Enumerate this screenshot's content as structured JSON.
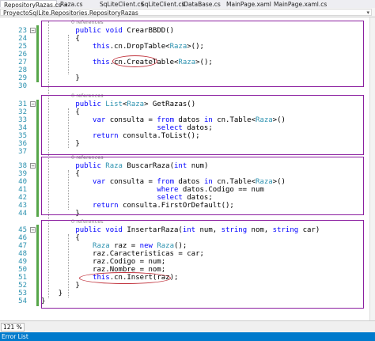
{
  "tabs": [
    {
      "label": "RepositoryRazas.cs",
      "active": true
    },
    {
      "label": "Raza.cs"
    },
    {
      "label": "SqLiteClient.cs"
    },
    {
      "label": "SqLiteClient.cs"
    },
    {
      "label": "IDataBase.cs"
    },
    {
      "label": "MainPage.xaml"
    },
    {
      "label": "MainPage.xaml.cs"
    }
  ],
  "navbar": {
    "member": "ProyectoSqlLite.Repositories.RepositoryRazas"
  },
  "codelens": "0 references",
  "lines": [
    {
      "n": "23",
      "parts": [
        [
          "        ",
          ""
        ],
        [
          "public void",
          "kw"
        ],
        [
          " CrearBBDD()",
          ""
        ]
      ]
    },
    {
      "n": "24",
      "parts": [
        [
          "        {",
          ""
        ]
      ]
    },
    {
      "n": "25",
      "parts": [
        [
          "            ",
          ""
        ],
        [
          "this",
          "kw"
        ],
        [
          ".cn.DropTable<",
          ""
        ],
        [
          "Raza",
          "ty"
        ],
        [
          ">();",
          ""
        ]
      ]
    },
    {
      "n": "26",
      "parts": [
        [
          "",
          ""
        ]
      ]
    },
    {
      "n": "27",
      "parts": [
        [
          "            ",
          ""
        ],
        [
          "this",
          "kw"
        ],
        [
          ".cn.CreateTable<",
          ""
        ],
        [
          "Raza",
          "ty"
        ],
        [
          ">();",
          ""
        ]
      ]
    },
    {
      "n": "28",
      "parts": [
        [
          "",
          ""
        ]
      ]
    },
    {
      "n": "29",
      "parts": [
        [
          "        }",
          ""
        ]
      ]
    },
    {
      "n": "30",
      "parts": [
        [
          "",
          ""
        ]
      ]
    },
    {
      "n": "31",
      "parts": [
        [
          "        ",
          ""
        ],
        [
          "public",
          "kw"
        ],
        [
          " ",
          ""
        ],
        [
          "List",
          "ty"
        ],
        [
          "<",
          ""
        ],
        [
          "Raza",
          "ty"
        ],
        [
          "> GetRazas()",
          ""
        ]
      ]
    },
    {
      "n": "32",
      "parts": [
        [
          "        {",
          ""
        ]
      ]
    },
    {
      "n": "33",
      "parts": [
        [
          "            ",
          ""
        ],
        [
          "var",
          "kw"
        ],
        [
          " consulta = ",
          ""
        ],
        [
          "from",
          "kw"
        ],
        [
          " datos ",
          ""
        ],
        [
          "in",
          "kw"
        ],
        [
          " cn.Table<",
          ""
        ],
        [
          "Raza",
          "ty"
        ],
        [
          ">()",
          ""
        ]
      ]
    },
    {
      "n": "34",
      "parts": [
        [
          "                           ",
          ""
        ],
        [
          "select",
          "kw"
        ],
        [
          " datos;",
          ""
        ]
      ]
    },
    {
      "n": "35",
      "parts": [
        [
          "            ",
          ""
        ],
        [
          "return",
          "kw"
        ],
        [
          " consulta.ToList();",
          ""
        ]
      ]
    },
    {
      "n": "36",
      "parts": [
        [
          "        }",
          ""
        ]
      ]
    },
    {
      "n": "37",
      "parts": [
        [
          "",
          ""
        ]
      ]
    },
    {
      "n": "38",
      "parts": [
        [
          "        ",
          ""
        ],
        [
          "public",
          "kw"
        ],
        [
          " ",
          ""
        ],
        [
          "Raza",
          "ty"
        ],
        [
          " BuscarRaza(",
          ""
        ],
        [
          "int",
          "kw"
        ],
        [
          " num)",
          ""
        ]
      ]
    },
    {
      "n": "39",
      "parts": [
        [
          "        {",
          ""
        ]
      ]
    },
    {
      "n": "40",
      "parts": [
        [
          "            ",
          ""
        ],
        [
          "var",
          "kw"
        ],
        [
          " consulta = ",
          ""
        ],
        [
          "from",
          "kw"
        ],
        [
          " datos ",
          ""
        ],
        [
          "in",
          "kw"
        ],
        [
          " cn.Table<",
          ""
        ],
        [
          "Raza",
          "ty"
        ],
        [
          ">()",
          ""
        ]
      ]
    },
    {
      "n": "41",
      "parts": [
        [
          "                           ",
          ""
        ],
        [
          "where",
          "kw"
        ],
        [
          " datos.Codigo == num",
          ""
        ]
      ]
    },
    {
      "n": "42",
      "parts": [
        [
          "                           ",
          ""
        ],
        [
          "select",
          "kw"
        ],
        [
          " datos;",
          ""
        ]
      ]
    },
    {
      "n": "43",
      "parts": [
        [
          "            ",
          ""
        ],
        [
          "return",
          "kw"
        ],
        [
          " consulta.FirstOrDefault();",
          ""
        ]
      ]
    },
    {
      "n": "44",
      "parts": [
        [
          "        }",
          ""
        ]
      ]
    },
    {
      "n": "45",
      "parts": [
        [
          "        ",
          ""
        ],
        [
          "public void",
          "kw"
        ],
        [
          " InsertarRaza(",
          ""
        ],
        [
          "int",
          "kw"
        ],
        [
          " num, ",
          ""
        ],
        [
          "string",
          "kw"
        ],
        [
          " nom, ",
          ""
        ],
        [
          "string",
          "kw"
        ],
        [
          " car)",
          ""
        ]
      ]
    },
    {
      "n": "46",
      "parts": [
        [
          "        {",
          ""
        ]
      ]
    },
    {
      "n": "47",
      "parts": [
        [
          "            ",
          ""
        ],
        [
          "Raza",
          "ty"
        ],
        [
          " raz = ",
          ""
        ],
        [
          "new",
          "kw"
        ],
        [
          " ",
          ""
        ],
        [
          "Raza",
          "ty"
        ],
        [
          "();",
          ""
        ]
      ]
    },
    {
      "n": "48",
      "parts": [
        [
          "            raz.Caracteristicas = car;",
          ""
        ]
      ]
    },
    {
      "n": "49",
      "parts": [
        [
          "            raz.Codigo = num;",
          ""
        ]
      ]
    },
    {
      "n": "50",
      "parts": [
        [
          "            raz.Nombre = nom;",
          ""
        ]
      ]
    },
    {
      "n": "51",
      "parts": [
        [
          "            ",
          ""
        ],
        [
          "this",
          "kw"
        ],
        [
          ".cn.Insert(raz);",
          ""
        ]
      ]
    },
    {
      "n": "52",
      "parts": [
        [
          "        }",
          ""
        ]
      ]
    },
    {
      "n": "53",
      "parts": [
        [
          "    }",
          ""
        ]
      ]
    },
    {
      "n": "54",
      "parts": [
        [
          "}",
          ""
        ]
      ]
    }
  ],
  "status": {
    "zoom": "121 %"
  },
  "panel": {
    "title": "Error List"
  }
}
